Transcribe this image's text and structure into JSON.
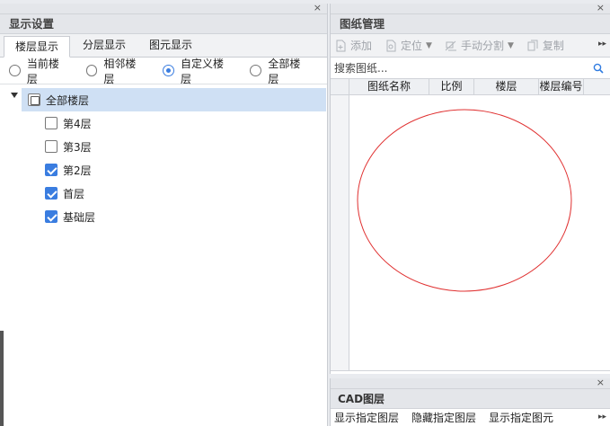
{
  "display_settings": {
    "title": "显示设置",
    "tabs": [
      {
        "label": "楼层显示",
        "active": true
      },
      {
        "label": "分层显示",
        "active": false
      },
      {
        "label": "图元显示",
        "active": false
      }
    ],
    "radios": [
      {
        "label": "当前楼层",
        "selected": false
      },
      {
        "label": "相邻楼层",
        "selected": false
      },
      {
        "label": "自定义楼层",
        "selected": true
      },
      {
        "label": "全部楼层",
        "selected": false
      }
    ],
    "tree": {
      "root": {
        "label": "全部楼层",
        "state": "partial"
      },
      "children": [
        {
          "label": "第4层",
          "checked": false
        },
        {
          "label": "第3层",
          "checked": false
        },
        {
          "label": "第2层",
          "checked": true
        },
        {
          "label": "首层",
          "checked": true
        },
        {
          "label": "基础层",
          "checked": true
        }
      ]
    }
  },
  "drawing_manager": {
    "title": "图纸管理",
    "toolbar": {
      "add": "添加",
      "locate": "定位",
      "manual_split": "手动分割",
      "copy": "复制"
    },
    "search_placeholder": "搜索图纸...",
    "columns": [
      "图纸名称",
      "比例",
      "楼层",
      "楼层编号"
    ]
  },
  "cad_layers": {
    "title": "CAD图层",
    "buttons": [
      "显示指定图层",
      "隐藏指定图层",
      "显示指定图元"
    ]
  },
  "colors": {
    "accent": "#3a7de0",
    "selection": "#cfe0f4",
    "ellipse": "#e03030",
    "disabled_text": "#a0a4aa"
  },
  "icons": {
    "close": "×",
    "more": "▸▸",
    "search": "magnifier-icon"
  }
}
